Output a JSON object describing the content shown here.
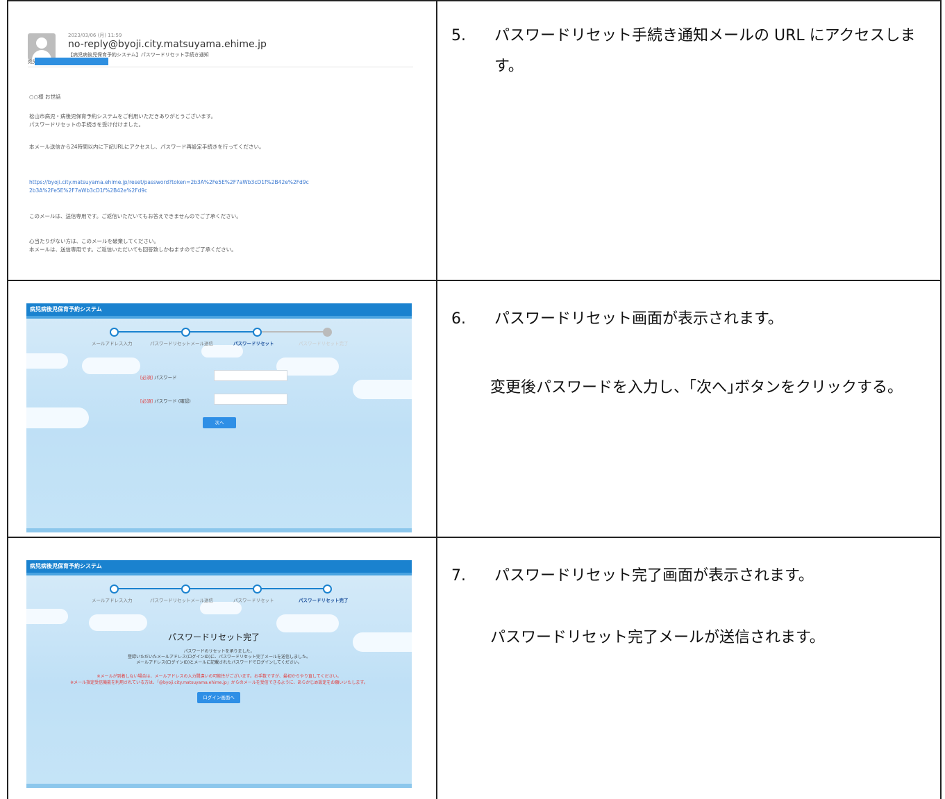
{
  "rows": [
    {
      "step_num": "5.",
      "step_text": "パスワードリセット手続き通知メールの URL にアクセスします。",
      "email": {
        "date": "2023/03/06 (月) 11:59",
        "from": "no-reply@byoji.city.matsuyama.ehime.jp",
        "subject": "【病児病後児保育予約システム】パスワードリセット手続き通知",
        "to_label": "宛先",
        "body": [
          "○○様 お世話",
          "松山市病児・病後児保育予約システムをご利用いただきありがとうございます。",
          "パスワードリセットの手続きを受け付けました。",
          "本メール送信から24時間以内に下記URLにアクセスし、パスワード再設定手続きを行ってください。",
          "https://byoji.city.matsuyama.ehime.jp/reset/password?token=2b3A%2Fe5E%2F7aWb3cD1f%2B42e%2Fd9c",
          "2b3A%2Fe5E%2F7aWb3cD1f%2B42e%2Fd9c",
          "このメールは、送信専用です。ご返信いただいてもお答えできませんのでご了承ください。",
          "心当たりがない方は、このメールを破棄してください。",
          "本メールは、送信専用です。ご返信いただいても回答致しかねますのでご了承ください。"
        ]
      }
    },
    {
      "step_num": "6.",
      "step_text": "パスワードリセット画面が表示されます。",
      "sub_text": "変更後パスワードを入力し、｢次へ｣ボタンをクリックする。",
      "screen": {
        "app_title": "病児病後児保育予約システム",
        "steps": [
          "メールアドレス入力",
          "パスワードリセットメール送信",
          "パスワードリセット",
          "パスワードリセット完了"
        ],
        "field1_req": "[必須]",
        "field1_label": "パスワード",
        "field2_req": "[必須]",
        "field2_label": "パスワード (確認)",
        "next_label": "次へ"
      }
    },
    {
      "step_num": "7.",
      "step_text": "パスワードリセット完了画面が表示されます。",
      "sub_text": "パスワードリセット完了メールが送信されます。",
      "screen": {
        "app_title": "病児病後児保育予約システム",
        "steps": [
          "メールアドレス入力",
          "パスワードリセットメール送信",
          "パスワードリセット",
          "パスワードリセット完了"
        ],
        "done_title": "パスワードリセット完了",
        "msg1": "パスワードのリセットを承りました。",
        "msg2": "登録いただいたメールアドレス(ログインID)に、パスワードリセット完了メールを送信しました。",
        "msg3": "メールアドレス(ログインID)とメールに記載されたパスワードでログインしてください。",
        "warn1": "※メールが到着しない場合は、メールアドレスの入力間違いの可能性がございます。お手数ですが、最初からやり直してください。",
        "warn2": "※メール指定受信機能を利用されている方は、「@byoji.city.matsuyama.ehime.jp」からのメールを受信できるように、あらかじめ設定をお願いいたします。",
        "login_label": "ログイン画面へ"
      }
    }
  ]
}
